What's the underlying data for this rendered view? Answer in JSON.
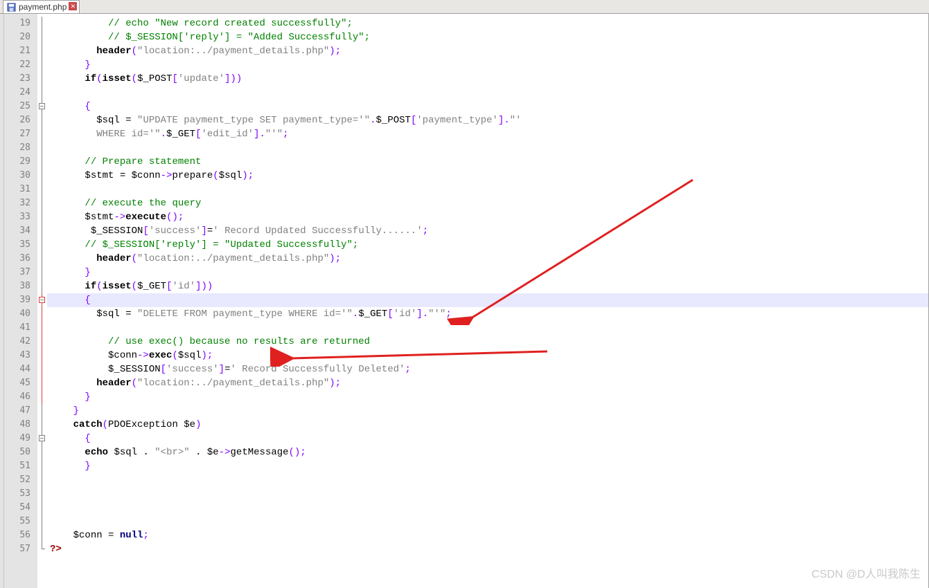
{
  "tab": {
    "filename": "payment.php"
  },
  "lineStart": 19,
  "lineEnd": 57,
  "highlightedLine": 39,
  "watermark": "CSDN @D人叫我陈生",
  "code": {
    "19": {
      "indent": 10,
      "comment": "// echo \"New record created successfully\";"
    },
    "20": {
      "indent": 10,
      "comment": "// $_SESSION['reply'] = \"Added Successfully\";"
    },
    "21": {
      "indent": 8,
      "kw": "header",
      "rest": "(",
      "str": "\"location:../payment_details.php\"",
      "tail": ");"
    },
    "22": {
      "indent": 6,
      "brace": "}"
    },
    "23": {
      "indent": 6,
      "p1": "if",
      "p2": "(",
      "p3": "isset",
      "p4": "(",
      "var": "$_POST",
      "idx": "['update']",
      "tail": "))"
    },
    "24": {
      "blank": true
    },
    "25": {
      "indent": 6,
      "brace": "{"
    },
    "26": {
      "indent": 8,
      "var1": "$sql",
      "eq": " = ",
      "str1": "\"UPDATE payment_type SET payment_type='\"",
      "dot1": ".",
      "var2": "$_POST",
      "idx2": "['payment_type']",
      "dot2": ".",
      "str2": "\"'"
    },
    "27": {
      "indent": 8,
      "str1": "WHERE id='\"",
      "dot1": ".",
      "var": "$_GET",
      "idx": "['edit_id']",
      "dot2": ".",
      "str2": "\"'\"",
      "tail": ";"
    },
    "28": {
      "blank": true
    },
    "29": {
      "indent": 6,
      "comment": "// Prepare statement"
    },
    "30": {
      "indent": 6,
      "var1": "$stmt",
      "eq": " = ",
      "var2": "$conn",
      "arrow": "->",
      "fn": "prepare",
      "paren": "(",
      "arg": "$sql",
      "tail": ");"
    },
    "31": {
      "blank": true
    },
    "32": {
      "indent": 6,
      "comment": "// execute the query"
    },
    "33": {
      "indent": 6,
      "var": "$stmt",
      "arrow": "->",
      "fn": "execute",
      "tail": "();"
    },
    "34": {
      "indent": 7,
      "var": "$_SESSION",
      "idx": "['success']",
      "eq": "=",
      "str": "' Record Updated Successfully......'",
      "tail": ";"
    },
    "35": {
      "indent": 6,
      "comment": "// $_SESSION['reply'] = \"Updated Successfully\";"
    },
    "36": {
      "indent": 8,
      "kw": "header",
      "paren": "(",
      "str": "\"location:../payment_details.php\"",
      "tail": ");"
    },
    "37": {
      "indent": 6,
      "brace": "}"
    },
    "38": {
      "indent": 6,
      "p1": "if",
      "p2": "(",
      "p3": "isset",
      "p4": "(",
      "var": "$_GET",
      "idx": "['id']",
      "tail": "))"
    },
    "39": {
      "indent": 6,
      "brace": "{"
    },
    "40": {
      "indent": 8,
      "var1": "$sql",
      "eq": " = ",
      "str1": "\"DELETE FROM payment_type WHERE id='\"",
      "dot1": ".",
      "var2": "$_GET",
      "idx2": "['id']",
      "dot2": ".",
      "str2": "\"'\"",
      "tail": ";"
    },
    "41": {
      "blank": true
    },
    "42": {
      "indent": 10,
      "comment": "// use exec() because no results are returned"
    },
    "43": {
      "indent": 10,
      "var": "$conn",
      "arrow": "->",
      "fn": "exec",
      "paren": "(",
      "arg": "$sql",
      "tail": ");"
    },
    "44": {
      "indent": 10,
      "var": "$_SESSION",
      "idx": "['success']",
      "eq": "=",
      "str": "' Record Successfully Deleted'",
      "tail": ";"
    },
    "45": {
      "indent": 8,
      "kw": "header",
      "paren": "(",
      "str": "\"location:../payment_details.php\"",
      "tail": ");"
    },
    "46": {
      "indent": 6,
      "brace": "}"
    },
    "47": {
      "indent": 4,
      "brace": "}"
    },
    "48": {
      "indent": 4,
      "p1": "catch",
      "paren": "(",
      "cls": "PDOException ",
      "var": "$e",
      "tail": ")"
    },
    "49": {
      "indent": 6,
      "brace": "{"
    },
    "50": {
      "indent": 6,
      "kw": "echo",
      "sp": " ",
      "var1": "$sql",
      "dot1": " . ",
      "str": "\"<br>\"",
      "dot2": " . ",
      "var2": "$e",
      "arrow": "->",
      "fn": "getMessage",
      "tail": "();"
    },
    "51": {
      "indent": 6,
      "brace": "}"
    },
    "52": {
      "blank": true
    },
    "53": {
      "blank": true
    },
    "54": {
      "blank": true
    },
    "55": {
      "blank": true
    },
    "56": {
      "indent": 4,
      "var": "$conn",
      "eq": " = ",
      "kw": "null",
      "tail": ";"
    },
    "57": {
      "indent": 0,
      "phptag": "?>"
    }
  },
  "foldBoxes": [
    25,
    39,
    49
  ],
  "redFoldBoxes": [
    39
  ],
  "foldCorner": 57
}
